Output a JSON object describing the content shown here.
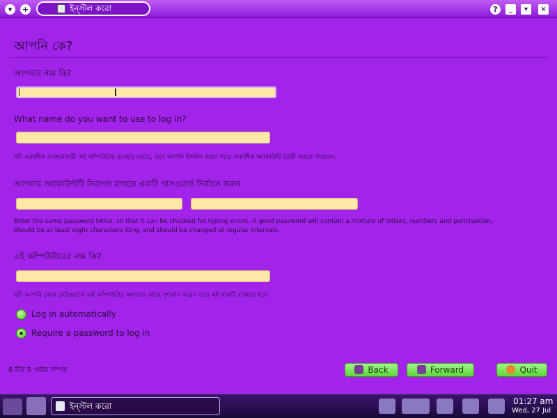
{
  "window": {
    "title": "ইন্স্টল করো",
    "controls": {
      "collapse": "▾",
      "add": "+",
      "help": "?",
      "minimize": "_",
      "maximize": "▾",
      "close": "×"
    }
  },
  "page": {
    "title": "আপনি কে?",
    "name_label": "আপনার নাম কি?",
    "name_value": "",
    "login_label": "What name do you want to use to log in?",
    "login_value": "",
    "login_help": "যদি একাধিক ব্যবহারকারী এই কম্পিউটার ব্যবহার করবে, তবে আপনি ইন্সটল করার পরও একাধিক অ্যাকাউন্ট তৈরী করতে পারবেন.",
    "password_label": "আপনার অ্যাকাউন্টটি নিরাপদ রাখতে একটি পাসওয়ার্ড নির্বাচন করুন",
    "password_value": "",
    "password_confirm_value": "",
    "password_help_line1": "Enter the same password twice, so that it can be checked for typing errors. A good password will contain a mixture of letters, numbers and punctuation,",
    "password_help_line2": "should be at least eight characters long, and should be changed at regular intervals.",
    "computer_label": "এই কম্পিউটারের নাম কি?",
    "computer_value": "",
    "computer_help": "যদি আপনি কোন নেটওয়ার্কে এই কম্পিউটার অন্যদের কাছে দৃশ্যমান করেন তবে এই নামটি ব্যবহৃত হবে",
    "login_options": [
      {
        "label": "Log in automatically",
        "selected": false
      },
      {
        "label": "Require a password to log in",
        "selected": true
      }
    ],
    "step_text": "6 টির 5 পর্যায় সম্পন্ন"
  },
  "buttons": {
    "back": "Back",
    "forward": "Forward",
    "quit": "Quit"
  },
  "taskbar": {
    "task_label": "ইন্স্টল করো",
    "time": "01:27 am",
    "date": "Wed, 27 Jul"
  },
  "colors": {
    "background": "#a223ea",
    "field": "#fde8a8",
    "button": "#7ee65a",
    "taskbar": "#2a0b4a"
  }
}
